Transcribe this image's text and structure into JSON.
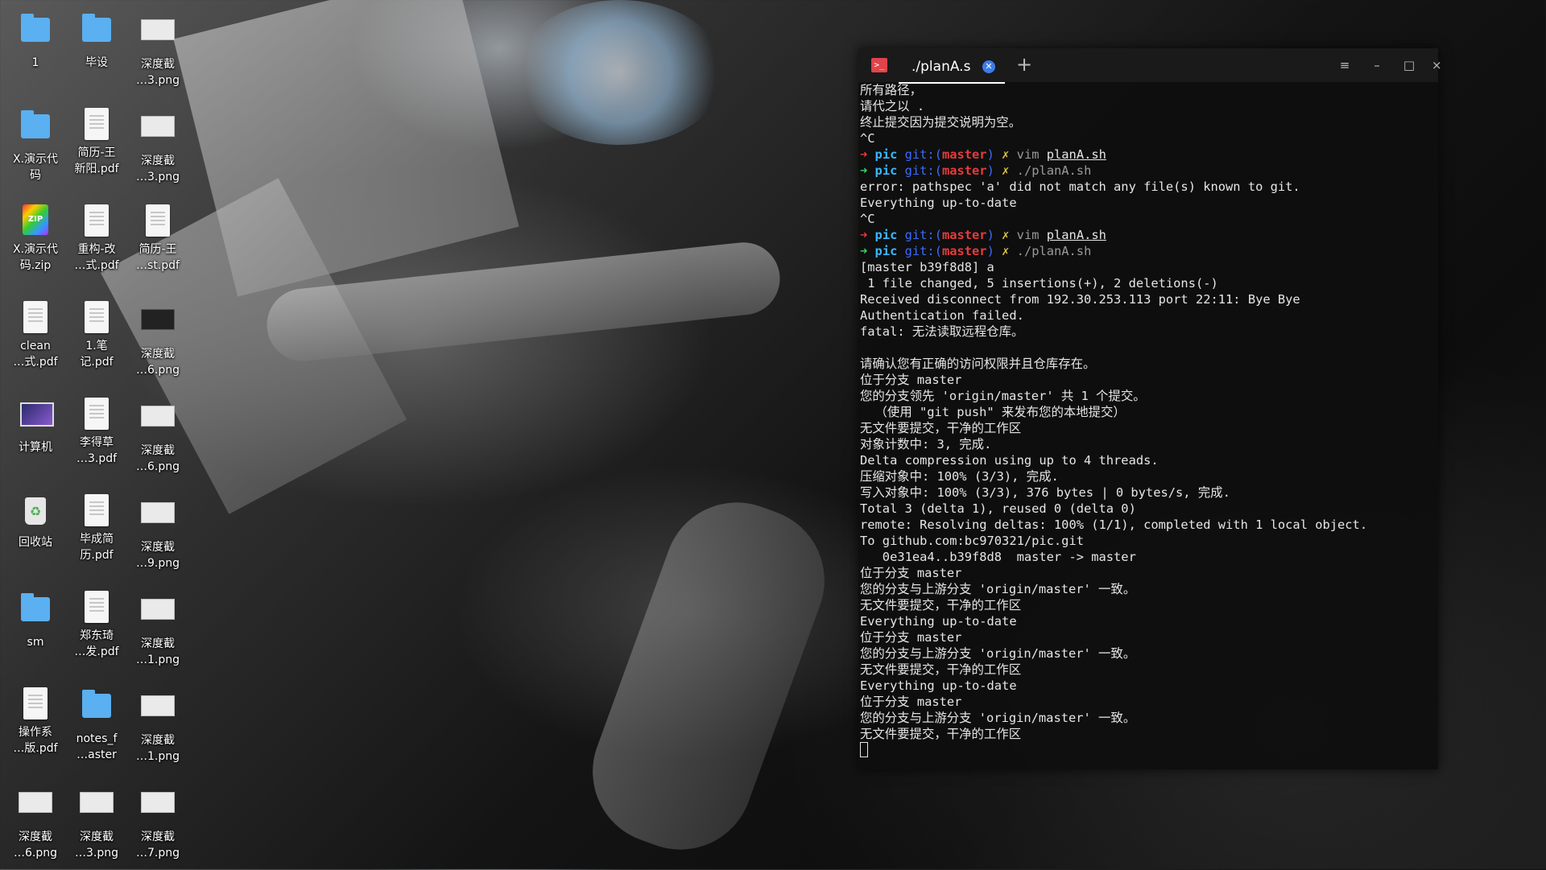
{
  "desktop": {
    "icons": [
      {
        "label_lines": [
          "1"
        ],
        "icon": "folder-icon",
        "type": "folder"
      },
      {
        "label_lines": [
          "毕设"
        ],
        "icon": "folder-icon",
        "type": "folder"
      },
      {
        "label_lines": [
          "深度截",
          "…3.png"
        ],
        "icon": "image-file-icon",
        "type": "shot"
      },
      {
        "label_lines": [
          "X.演示代",
          "码"
        ],
        "icon": "folder-icon",
        "type": "folder"
      },
      {
        "label_lines": [
          "简历-王",
          "新阳.pdf"
        ],
        "icon": "pdf-file-icon",
        "type": "doc"
      },
      {
        "label_lines": [
          "深度截",
          "…3.png"
        ],
        "icon": "image-file-icon",
        "type": "shot"
      },
      {
        "label_lines": [
          "X.演示代",
          "码.zip"
        ],
        "icon": "zip-file-icon",
        "type": "zip"
      },
      {
        "label_lines": [
          "重构-改",
          "…式.pdf"
        ],
        "icon": "pdf-file-icon",
        "type": "doc"
      },
      {
        "label_lines": [
          "简历-王",
          "…st.pdf"
        ],
        "icon": "pdf-file-icon",
        "type": "doc"
      },
      {
        "label_lines": [
          "clean",
          "…式.pdf"
        ],
        "icon": "pdf-file-icon",
        "type": "doc"
      },
      {
        "label_lines": [
          "1.笔",
          "记.pdf"
        ],
        "icon": "pdf-file-icon",
        "type": "doc"
      },
      {
        "label_lines": [
          "深度截",
          "…6.png"
        ],
        "icon": "image-file-icon",
        "type": "shot-dark"
      },
      {
        "label_lines": [
          "计算机"
        ],
        "icon": "computer-icon",
        "type": "monitor"
      },
      {
        "label_lines": [
          "李得草",
          "…3.pdf"
        ],
        "icon": "pdf-file-icon",
        "type": "doc"
      },
      {
        "label_lines": [
          "深度截",
          "…6.png"
        ],
        "icon": "image-file-icon",
        "type": "shot"
      },
      {
        "label_lines": [
          "回收站"
        ],
        "icon": "trash-icon",
        "type": "trash"
      },
      {
        "label_lines": [
          "毕成简",
          "历.pdf"
        ],
        "icon": "pdf-file-icon",
        "type": "doc"
      },
      {
        "label_lines": [
          "深度截",
          "…9.png"
        ],
        "icon": "image-file-icon",
        "type": "shot"
      },
      {
        "label_lines": [
          "sm"
        ],
        "icon": "folder-icon",
        "type": "folder"
      },
      {
        "label_lines": [
          "郑东琦",
          "…发.pdf"
        ],
        "icon": "pdf-file-icon",
        "type": "doc"
      },
      {
        "label_lines": [
          "深度截",
          "…1.png"
        ],
        "icon": "image-file-icon",
        "type": "shot"
      },
      {
        "label_lines": [
          "操作系",
          "…版.pdf"
        ],
        "icon": "pdf-file-icon",
        "type": "doc"
      },
      {
        "label_lines": [
          "notes_f",
          "…aster"
        ],
        "icon": "folder-icon",
        "type": "folder"
      },
      {
        "label_lines": [
          "深度截",
          "…1.png"
        ],
        "icon": "image-file-icon",
        "type": "shot"
      },
      {
        "label_lines": [
          "深度截",
          "…6.png"
        ],
        "icon": "image-file-icon",
        "type": "shot"
      },
      {
        "label_lines": [
          "深度截",
          "…3.png"
        ],
        "icon": "image-file-icon",
        "type": "shot"
      },
      {
        "label_lines": [
          "深度截",
          "…7.png"
        ],
        "icon": "image-file-icon",
        "type": "shot"
      }
    ]
  },
  "terminal": {
    "tab_title": "./planA.s",
    "app_icon": ">_",
    "new_tab": "+",
    "controls": {
      "menu": "≡",
      "minimize": "–",
      "maximize": "□",
      "close": "×"
    },
    "lines": [
      [
        {
          "t": "所有路径，"
        }
      ],
      [
        {
          "t": "请代之以 ."
        }
      ],
      [
        {
          "t": "终止提交因为提交说明为空。"
        }
      ],
      [
        {
          "t": "^C"
        }
      ],
      [
        {
          "t": "➜ ",
          "c": "red"
        },
        {
          "t": "pic ",
          "c": "cyan"
        },
        {
          "t": "git:(",
          "c": "blue"
        },
        {
          "t": "master",
          "c": "red"
        },
        {
          "t": ") ",
          "c": "blue"
        },
        {
          "t": "✗ ",
          "c": "yellow"
        },
        {
          "t": "vim ",
          "c": "gray"
        },
        {
          "t": "planA.sh",
          "c": "u"
        }
      ],
      [
        {
          "t": "➜ ",
          "c": "green"
        },
        {
          "t": "pic ",
          "c": "cyan"
        },
        {
          "t": "git:(",
          "c": "blue"
        },
        {
          "t": "master",
          "c": "red"
        },
        {
          "t": ") ",
          "c": "blue"
        },
        {
          "t": "✗ ",
          "c": "yellow"
        },
        {
          "t": "./planA.sh",
          "c": "gray"
        }
      ],
      [
        {
          "t": "error: pathspec 'a' did not match any file(s) known to git."
        }
      ],
      [
        {
          "t": "Everything up-to-date"
        }
      ],
      [
        {
          "t": "^C"
        }
      ],
      [
        {
          "t": "➜ ",
          "c": "red"
        },
        {
          "t": "pic ",
          "c": "cyan"
        },
        {
          "t": "git:(",
          "c": "blue"
        },
        {
          "t": "master",
          "c": "red"
        },
        {
          "t": ") ",
          "c": "blue"
        },
        {
          "t": "✗ ",
          "c": "yellow"
        },
        {
          "t": "vim ",
          "c": "gray"
        },
        {
          "t": "planA.sh",
          "c": "u"
        }
      ],
      [
        {
          "t": "➜ ",
          "c": "green"
        },
        {
          "t": "pic ",
          "c": "cyan"
        },
        {
          "t": "git:(",
          "c": "blue"
        },
        {
          "t": "master",
          "c": "red"
        },
        {
          "t": ") ",
          "c": "blue"
        },
        {
          "t": "✗ ",
          "c": "yellow"
        },
        {
          "t": "./planA.sh",
          "c": "gray"
        }
      ],
      [
        {
          "t": "[master b39f8d8] a"
        }
      ],
      [
        {
          "t": " 1 file changed, 5 insertions(+), 2 deletions(-)"
        }
      ],
      [
        {
          "t": "Received disconnect from 192.30.253.113 port 22:11: Bye Bye"
        }
      ],
      [
        {
          "t": "Authentication failed."
        }
      ],
      [
        {
          "t": "fatal: 无法读取远程仓库。"
        }
      ],
      [
        {
          "t": ""
        }
      ],
      [
        {
          "t": "请确认您有正确的访问权限并且仓库存在。"
        }
      ],
      [
        {
          "t": "位于分支 master"
        }
      ],
      [
        {
          "t": "您的分支领先 'origin/master' 共 1 个提交。"
        }
      ],
      [
        {
          "t": "  （使用 \"git push\" 来发布您的本地提交）"
        }
      ],
      [
        {
          "t": "无文件要提交，干净的工作区"
        }
      ],
      [
        {
          "t": "对象计数中: 3, 完成."
        }
      ],
      [
        {
          "t": "Delta compression using up to 4 threads."
        }
      ],
      [
        {
          "t": "压缩对象中: 100% (3/3), 完成."
        }
      ],
      [
        {
          "t": "写入对象中: 100% (3/3), 376 bytes | 0 bytes/s, 完成."
        }
      ],
      [
        {
          "t": "Total 3 (delta 1), reused 0 (delta 0)"
        }
      ],
      [
        {
          "t": "remote: Resolving deltas: 100% (1/1), completed with 1 local object."
        }
      ],
      [
        {
          "t": "To github.com:bc970321/pic.git"
        }
      ],
      [
        {
          "t": "   0e31ea4..b39f8d8  master -> master"
        }
      ],
      [
        {
          "t": "位于分支 master"
        }
      ],
      [
        {
          "t": "您的分支与上游分支 'origin/master' 一致。"
        }
      ],
      [
        {
          "t": "无文件要提交，干净的工作区"
        }
      ],
      [
        {
          "t": "Everything up-to-date"
        }
      ],
      [
        {
          "t": "位于分支 master"
        }
      ],
      [
        {
          "t": "您的分支与上游分支 'origin/master' 一致。"
        }
      ],
      [
        {
          "t": "无文件要提交，干净的工作区"
        }
      ],
      [
        {
          "t": "Everything up-to-date"
        }
      ],
      [
        {
          "t": "位于分支 master"
        }
      ],
      [
        {
          "t": "您的分支与上游分支 'origin/master' 一致。"
        }
      ],
      [
        {
          "t": "无文件要提交，干净的工作区"
        }
      ]
    ]
  }
}
